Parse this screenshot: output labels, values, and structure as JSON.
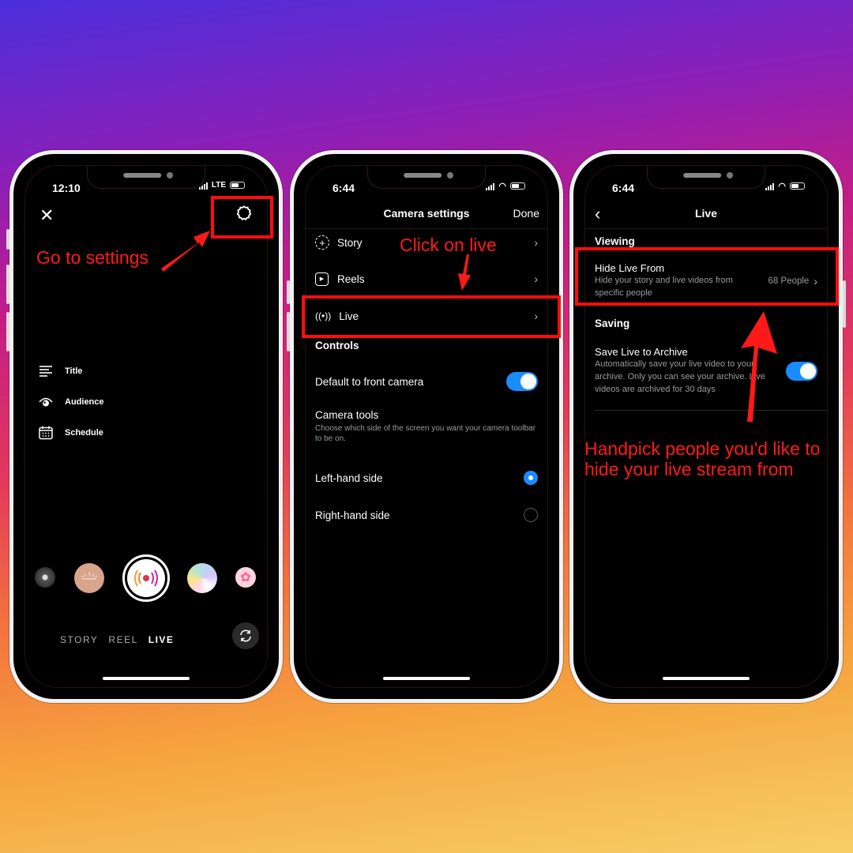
{
  "background": {
    "gradient": [
      "#4b2fdc",
      "#c41d86",
      "#f3723e",
      "#f7cf66"
    ]
  },
  "annotation_color": "#ff1a1a",
  "phone1": {
    "status": {
      "time": "12:10",
      "network": "LTE"
    },
    "close_icon": "close-icon",
    "settings_icon": "gear-icon",
    "annotation": "Go to settings",
    "menu": [
      {
        "icon": "title-lines-icon",
        "label": "Title"
      },
      {
        "icon": "audience-eye-icon",
        "label": "Audience"
      },
      {
        "icon": "calendar-icon",
        "label": "Schedule"
      }
    ],
    "effects": [
      "avatar-effect",
      "sunrise-effect",
      "live-record-button",
      "rainbow-effect",
      "flower-effect"
    ],
    "modes": [
      "STORY",
      "REEL",
      "LIVE"
    ],
    "active_mode": "LIVE",
    "flip_icon": "flip-camera-icon"
  },
  "phone2": {
    "status": {
      "time": "6:44"
    },
    "nav": {
      "title": "Camera settings",
      "done": "Done"
    },
    "annotation": "Click on live",
    "items": [
      {
        "icon": "story-add-icon",
        "label": "Story"
      },
      {
        "icon": "reels-icon",
        "label": "Reels"
      },
      {
        "icon": "live-broadcast-icon",
        "label": "Live"
      }
    ],
    "controls_header": "Controls",
    "front_camera": {
      "label": "Default to front camera",
      "on": true
    },
    "camera_tools": {
      "title": "Camera tools",
      "desc": "Choose which side of the screen you want your camera toolbar to be on."
    },
    "sides": [
      {
        "label": "Left-hand side",
        "selected": true
      },
      {
        "label": "Right-hand side",
        "selected": false
      }
    ]
  },
  "phone3": {
    "status": {
      "time": "6:44"
    },
    "nav": {
      "title": "Live"
    },
    "viewing_header": "Viewing",
    "hide_live": {
      "title": "Hide Live From",
      "desc": "Hide your story and live videos from specific people",
      "value": "68 People"
    },
    "saving_header": "Saving",
    "archive": {
      "title": "Save Live to Archive",
      "desc": "Automatically save your live video to your archive. Only you can see your archive. Live videos are archived for 30 days",
      "on": true
    },
    "annotation": "Handpick people you'd like to hide your live stream from"
  }
}
